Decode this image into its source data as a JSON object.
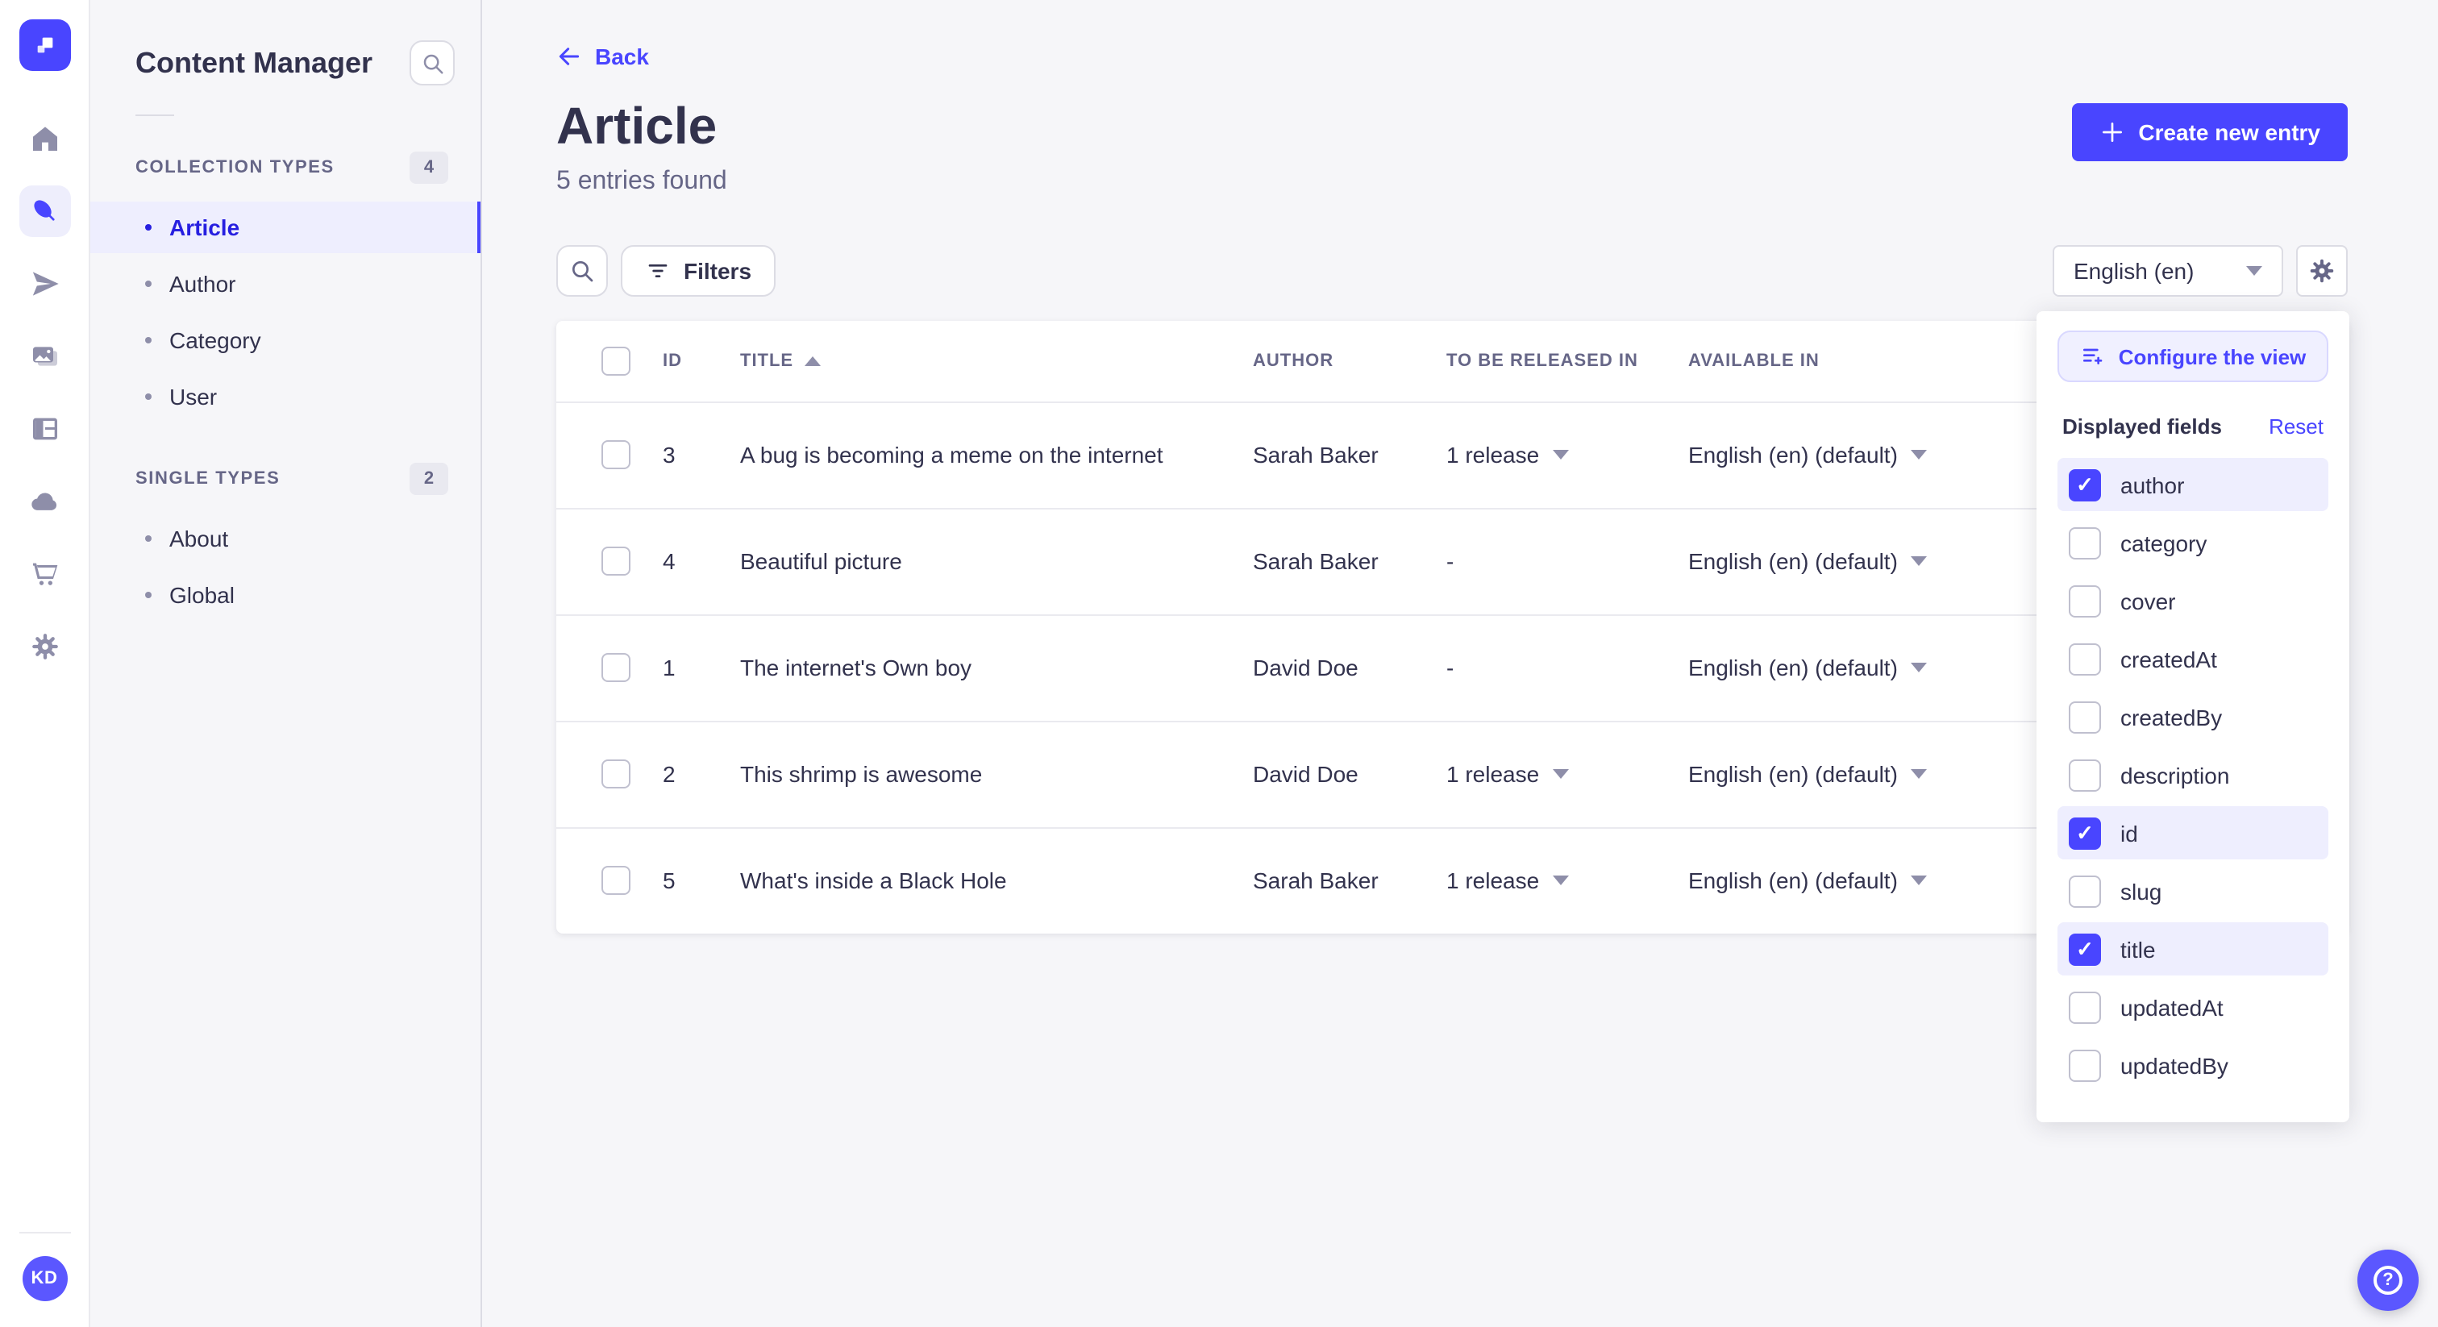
{
  "colors": {
    "primary": "#4945ff",
    "primary_light_bg": "#eeeefe",
    "primary_border": "#d9d8ff",
    "text_dark": "#32324d",
    "text_muted": "#666687",
    "app_bg": "#f6f6f9",
    "border": "#eaeaef"
  },
  "rail": {
    "logo": "strapi-logo",
    "avatar_initials": "KD"
  },
  "sidebar": {
    "title": "Content Manager",
    "sections": [
      {
        "label": "COLLECTION TYPES",
        "badge": "4",
        "items": [
          {
            "label": "Article",
            "active": true
          },
          {
            "label": "Author"
          },
          {
            "label": "Category"
          },
          {
            "label": "User"
          }
        ]
      },
      {
        "label": "SINGLE TYPES",
        "badge": "2",
        "items": [
          {
            "label": "About"
          },
          {
            "label": "Global"
          }
        ]
      }
    ]
  },
  "header": {
    "back_label": "Back",
    "title": "Article",
    "subtitle": "5 entries found",
    "create_button": "Create new entry"
  },
  "toolbar": {
    "filters_label": "Filters",
    "locale_value": "English (en)"
  },
  "table": {
    "headers": {
      "id": "ID",
      "title": "TITLE",
      "author": "AUTHOR",
      "release": "TO BE RELEASED IN",
      "available": "AVAILABLE IN"
    },
    "rows": [
      {
        "id": "3",
        "title": "A bug is becoming a meme on the internet",
        "author": "Sarah Baker",
        "release": "1 release",
        "available": "English (en) (default)"
      },
      {
        "id": "4",
        "title": "Beautiful picture",
        "author": "Sarah Baker",
        "release": "-",
        "available": "English (en) (default)"
      },
      {
        "id": "1",
        "title": "The internet's Own boy",
        "author": "David Doe",
        "release": "-",
        "available": "English (en) (default)"
      },
      {
        "id": "2",
        "title": "This shrimp is awesome",
        "author": "David Doe",
        "release": "1 release",
        "available": "English (en) (default)"
      },
      {
        "id": "5",
        "title": "What's inside a Black Hole",
        "author": "Sarah Baker",
        "release": "1 release",
        "available": "English (en) (default)"
      }
    ]
  },
  "popover": {
    "configure_label": "Configure the view",
    "fields_heading": "Displayed fields",
    "reset_label": "Reset",
    "fields": [
      {
        "label": "author",
        "checked": true
      },
      {
        "label": "category",
        "checked": false
      },
      {
        "label": "cover",
        "checked": false
      },
      {
        "label": "createdAt",
        "checked": false
      },
      {
        "label": "createdBy",
        "checked": false
      },
      {
        "label": "description",
        "checked": false
      },
      {
        "label": "id",
        "checked": true
      },
      {
        "label": "slug",
        "checked": false
      },
      {
        "label": "title",
        "checked": true
      },
      {
        "label": "updatedAt",
        "checked": false
      },
      {
        "label": "updatedBy",
        "checked": false
      }
    ]
  }
}
